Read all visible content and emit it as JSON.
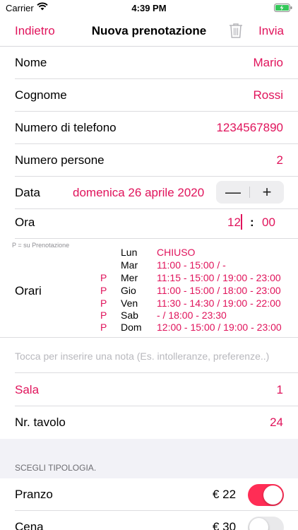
{
  "status_bar": {
    "carrier": "Carrier",
    "time": "4:39 PM"
  },
  "nav": {
    "back": "Indietro",
    "title": "Nuova prenotazione",
    "send": "Invia"
  },
  "form": {
    "nome_label": "Nome",
    "nome_value": "Mario",
    "cognome_label": "Cognome",
    "cognome_value": "Rossi",
    "telefono_label": "Numero di telefono",
    "telefono_value": "1234567890",
    "persone_label": "Numero persone",
    "persone_value": "2",
    "data_label": "Data",
    "data_value": "domenica 26 aprile 2020",
    "stepper_minus": "—",
    "stepper_plus": "+",
    "ora_label": "Ora",
    "ora_hour": "12",
    "ora_colon": ":",
    "ora_minutes": "00"
  },
  "orari": {
    "legend": "P = su Prenotazione",
    "label": "Orari",
    "schedule": [
      {
        "p": "",
        "day": "Lun",
        "hours": "CHIUSO"
      },
      {
        "p": "",
        "day": "Mar",
        "hours": "11:00 - 15:00 /  -"
      },
      {
        "p": "P",
        "day": "Mer",
        "hours": "11:15 - 15:00 / 19:00 - 23:00"
      },
      {
        "p": "P",
        "day": "Gio",
        "hours": "11:00 - 15:00 / 18:00 - 23:00"
      },
      {
        "p": "P",
        "day": "Ven",
        "hours": "11:30 - 14:30 / 19:00 - 22:00"
      },
      {
        "p": "P",
        "day": "Sab",
        "hours": " -  / 18:00 - 23:30"
      },
      {
        "p": "P",
        "day": "Dom",
        "hours": "12:00 - 15:00 / 19:00 - 23:00"
      }
    ]
  },
  "note": {
    "placeholder": "Tocca per inserire una nota (Es. intolleranze, preferenze..)"
  },
  "sala": {
    "label": "Sala",
    "value": "1"
  },
  "tavolo": {
    "label": "Nr. tavolo",
    "value": "24"
  },
  "tipologia": {
    "header": "SCEGLI TIPOLOGIA.",
    "items": [
      {
        "label": "Pranzo",
        "price": "€ 22",
        "enabled": true
      },
      {
        "label": "Cena",
        "price": "€ 30",
        "enabled": false
      }
    ]
  },
  "colors": {
    "accent": "#e0135b",
    "toggle_on": "#ff2d55",
    "toggle_off": "#e9e9eb"
  }
}
